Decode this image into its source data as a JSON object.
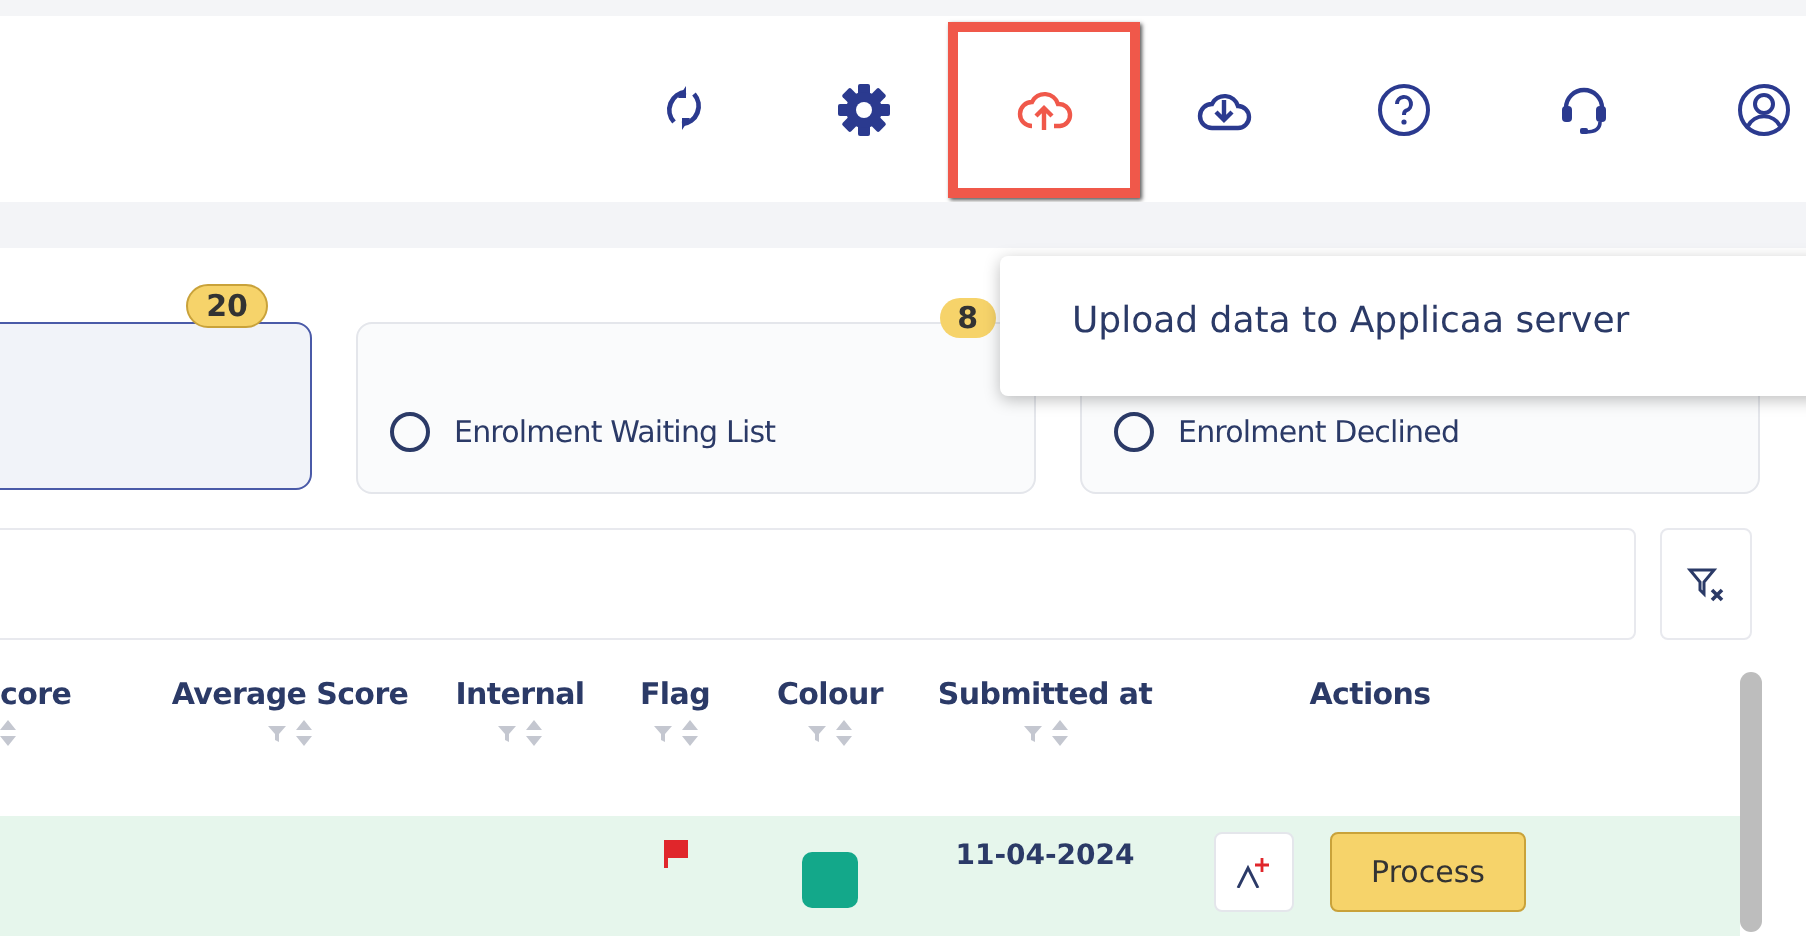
{
  "toolbar": {
    "buttons": [
      {
        "kind": "refresh",
        "highlighted": false
      },
      {
        "kind": "settings",
        "highlighted": false
      },
      {
        "kind": "upload",
        "highlighted": true
      },
      {
        "kind": "download",
        "highlighted": false
      },
      {
        "kind": "help",
        "highlighted": false
      },
      {
        "kind": "support",
        "highlighted": false
      },
      {
        "kind": "account",
        "highlighted": false
      }
    ]
  },
  "tooltip": {
    "text": "Upload data to Applicaa server"
  },
  "status_cards": [
    {
      "badge": "20",
      "selected": true
    },
    {
      "label": "Enrolment Waiting List",
      "badge": "8",
      "selected": false
    },
    {
      "label": "Enrolment Declined",
      "selected": false
    }
  ],
  "table": {
    "columns": [
      {
        "label": "core",
        "filterable": false,
        "sortable": true
      },
      {
        "label": "Average Score",
        "filterable": true,
        "sortable": true
      },
      {
        "label": "Internal",
        "filterable": true,
        "sortable": true
      },
      {
        "label": "Flag",
        "filterable": true,
        "sortable": true
      },
      {
        "label": "Colour",
        "filterable": true,
        "sortable": true
      },
      {
        "label": "Submitted at",
        "filterable": true,
        "sortable": true
      },
      {
        "label": "Actions",
        "filterable": false,
        "sortable": false
      }
    ],
    "rows": [
      {
        "flag": {
          "color": "#e0262b"
        },
        "colour_tag": {
          "color": "#13a88a"
        },
        "submitted_at": "11-04-2024",
        "action": "Process"
      }
    ]
  }
}
